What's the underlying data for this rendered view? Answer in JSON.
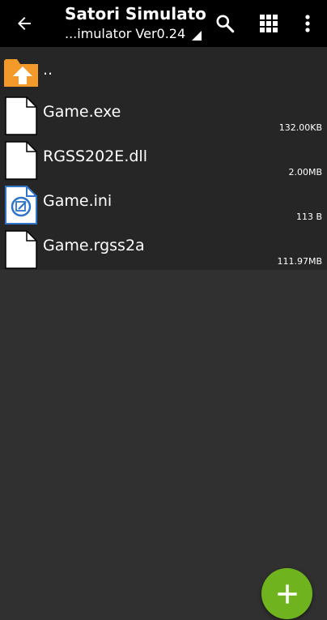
{
  "appbar": {
    "title": "Satori Simulato...",
    "subtitle": "...imulator Ver0.24"
  },
  "files": [
    {
      "name": "..",
      "type": "parent-folder",
      "size": ""
    },
    {
      "name": "Game.exe",
      "type": "file",
      "size": "132.00KB"
    },
    {
      "name": "RGSS202E.dll",
      "type": "file",
      "size": "2.00MB"
    },
    {
      "name": "Game.ini",
      "type": "ini-file",
      "size": "113 B"
    },
    {
      "name": "Game.rgss2a",
      "type": "file",
      "size": "111.97MB"
    }
  ],
  "colors": {
    "appbar_bg": "#000000",
    "list_bg": "#262626",
    "page_bg": "#303030",
    "folder_orange": "#f39a2b",
    "ini_blue": "#2f74c9",
    "fab_green": "#6fb41f"
  },
  "icons": {
    "back": "arrow-left",
    "search": "magnifier",
    "view": "grid-3x3",
    "more": "dots-vertical",
    "fab": "plus"
  }
}
